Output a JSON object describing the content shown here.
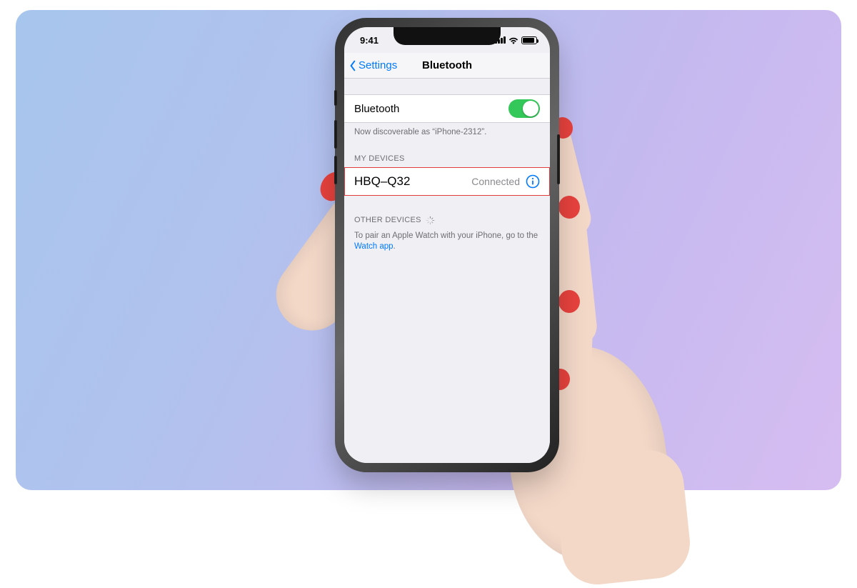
{
  "statusbar": {
    "time": "9:41"
  },
  "nav": {
    "back": "Settings",
    "title": "Bluetooth"
  },
  "bt_toggle": {
    "label": "Bluetooth",
    "on": true
  },
  "discoverable": "Now discoverable as “iPhone-2312”.",
  "sections": {
    "my_devices_header": "MY DEVICES",
    "other_devices_header": "OTHER DEVICES"
  },
  "my_devices": [
    {
      "name": "HBQ–Q32",
      "status": "Connected"
    }
  ],
  "pair_hint": {
    "prefix": "To pair an Apple Watch with your iPhone, go to the ",
    "link": "Watch app",
    "suffix": "."
  },
  "colors": {
    "ios_blue": "#007aff",
    "ios_green": "#34c759",
    "highlight": "#e23b3b"
  }
}
